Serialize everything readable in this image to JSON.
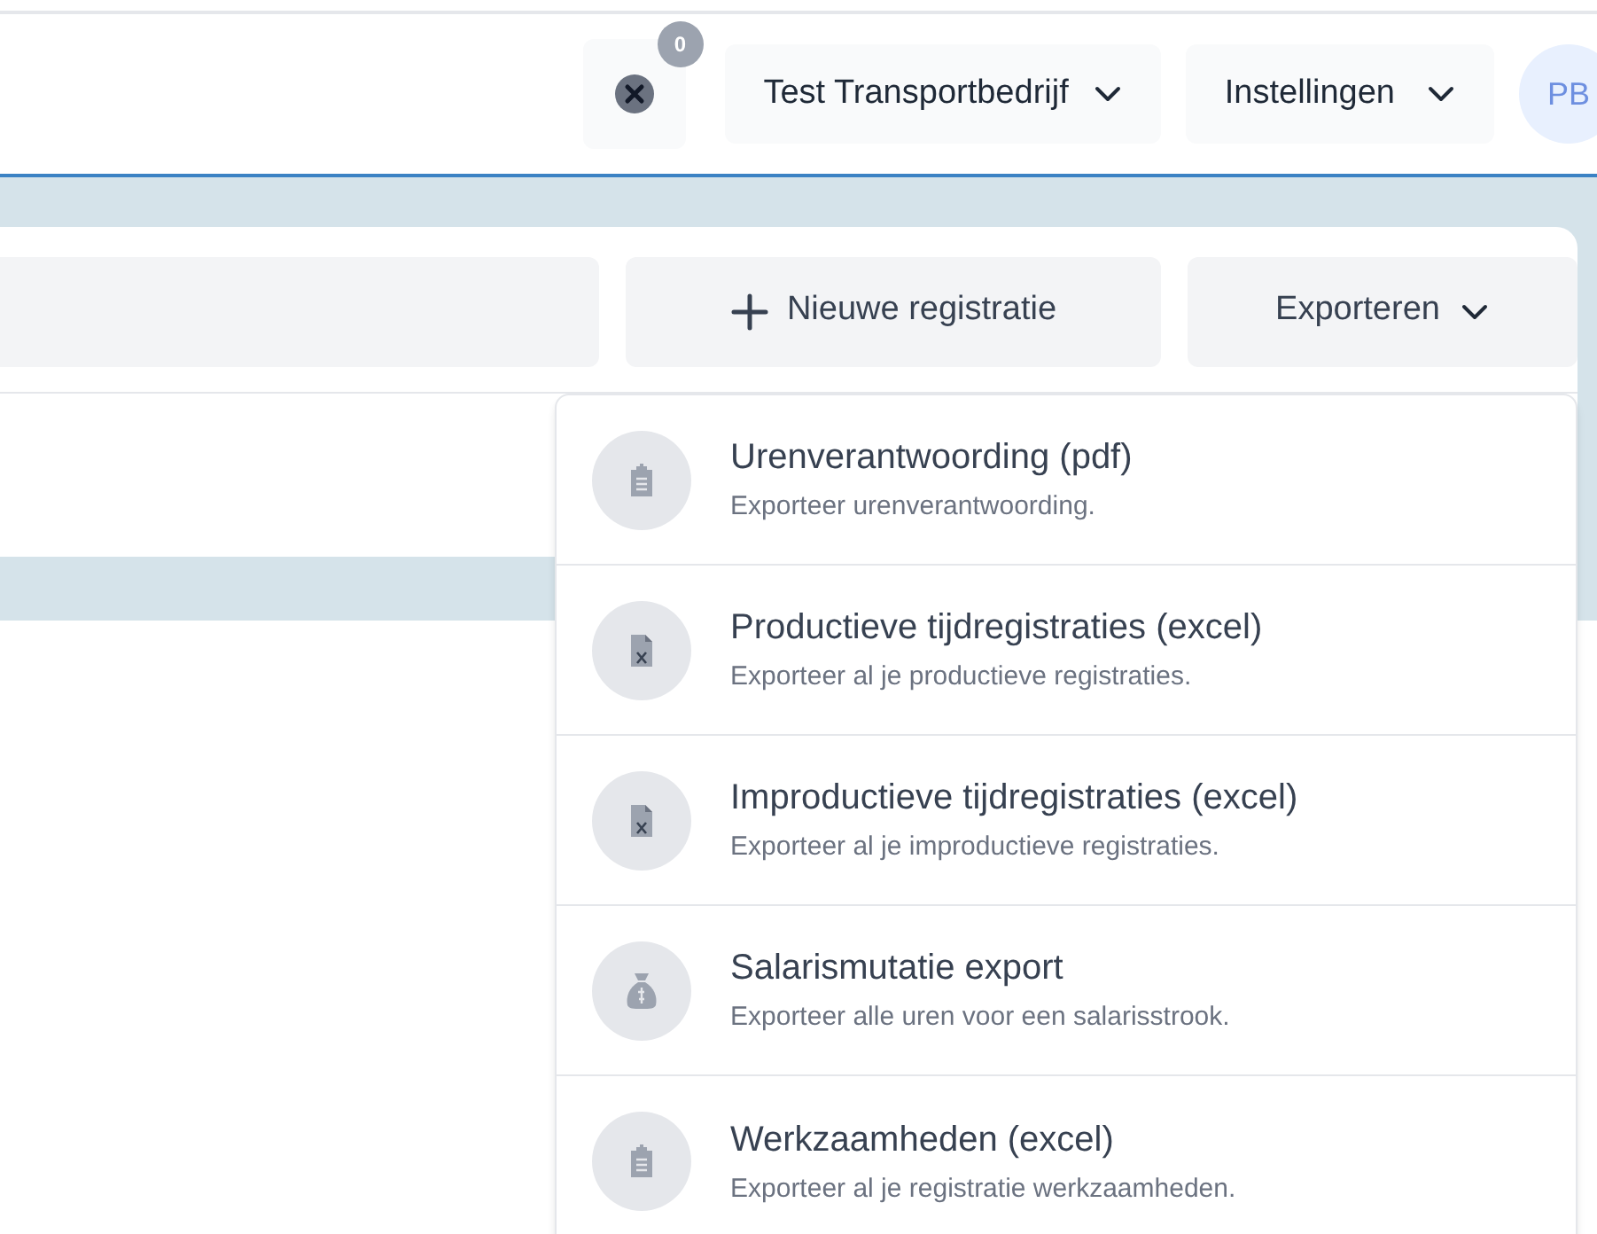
{
  "header": {
    "notifications": {
      "count": "0"
    },
    "company": "Test Transportbedrijf",
    "settings": "Instellingen",
    "avatar": "PB"
  },
  "toolbar": {
    "new_button": "Nieuwe registratie",
    "export_button": "Exporteren"
  },
  "export_menu": [
    {
      "kind": "clipboard",
      "title": "Urenverantwoording (pdf)",
      "description": "Exporteer urenverantwoording."
    },
    {
      "kind": "excel",
      "title": "Productieve tijdregistraties (excel)",
      "description": "Exporteer al je productieve registraties."
    },
    {
      "kind": "excel",
      "title": "Improductieve tijdregistraties (excel)",
      "description": "Exporteer al je improductieve registraties."
    },
    {
      "kind": "money",
      "title": "Salarismutatie export",
      "description": "Exporteer alle uren voor een salarisstrook."
    },
    {
      "kind": "clipboard",
      "title": "Werkzaamheden (excel)",
      "description": "Exporteer al je registratie werkzaamheden."
    }
  ]
}
